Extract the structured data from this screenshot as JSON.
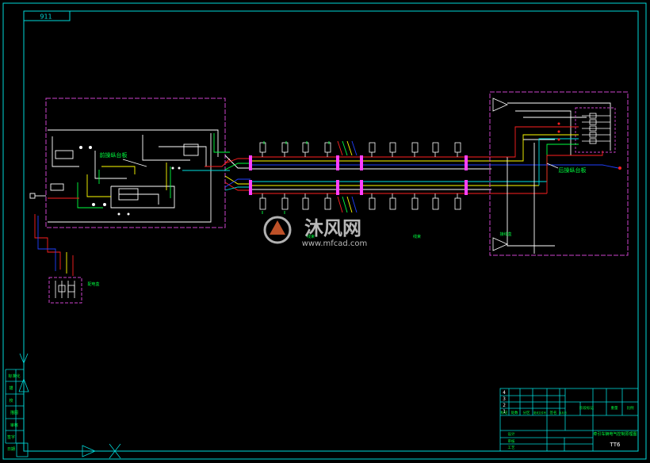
{
  "drawing": {
    "corner_code": "911",
    "drawing_number": "TT6",
    "title_cn": "牵引车辆电气控制原理图",
    "watermark_cn": "沐风网",
    "watermark_url": "www.mfcad.com"
  },
  "blocks": {
    "front_panel_label": "前操纵台板",
    "rear_panel_label": "后操纵台板",
    "side_box_label": "配电盒",
    "mid_label_1": "线束",
    "mid_label_2": "线束",
    "bottom_right_label": "接线盒"
  },
  "left_strip": {
    "items": [
      "标准化",
      "描",
      "校",
      "描图",
      "审核",
      "签字",
      "日期"
    ]
  },
  "title_block": {
    "rev_rows": [
      "4",
      "3",
      "2",
      "1"
    ],
    "rev_headers": [
      "标记",
      "处数",
      "分区",
      "更改文件号",
      "签名",
      "年月日"
    ],
    "role_rows": [
      "设计",
      "审核",
      "工艺"
    ],
    "stage_headers": [
      "阶段标记",
      "重量",
      "比例"
    ]
  },
  "colors": {
    "frame": "#00d8d8",
    "panel_border": "#cc44cc",
    "wire_white": "#ffffff",
    "wire_red": "#ff2020",
    "wire_yellow": "#ffff00",
    "wire_green": "#00ff40",
    "wire_blue": "#2040ff",
    "wire_cyan": "#00e0e0",
    "label_green": "#00ff40"
  }
}
